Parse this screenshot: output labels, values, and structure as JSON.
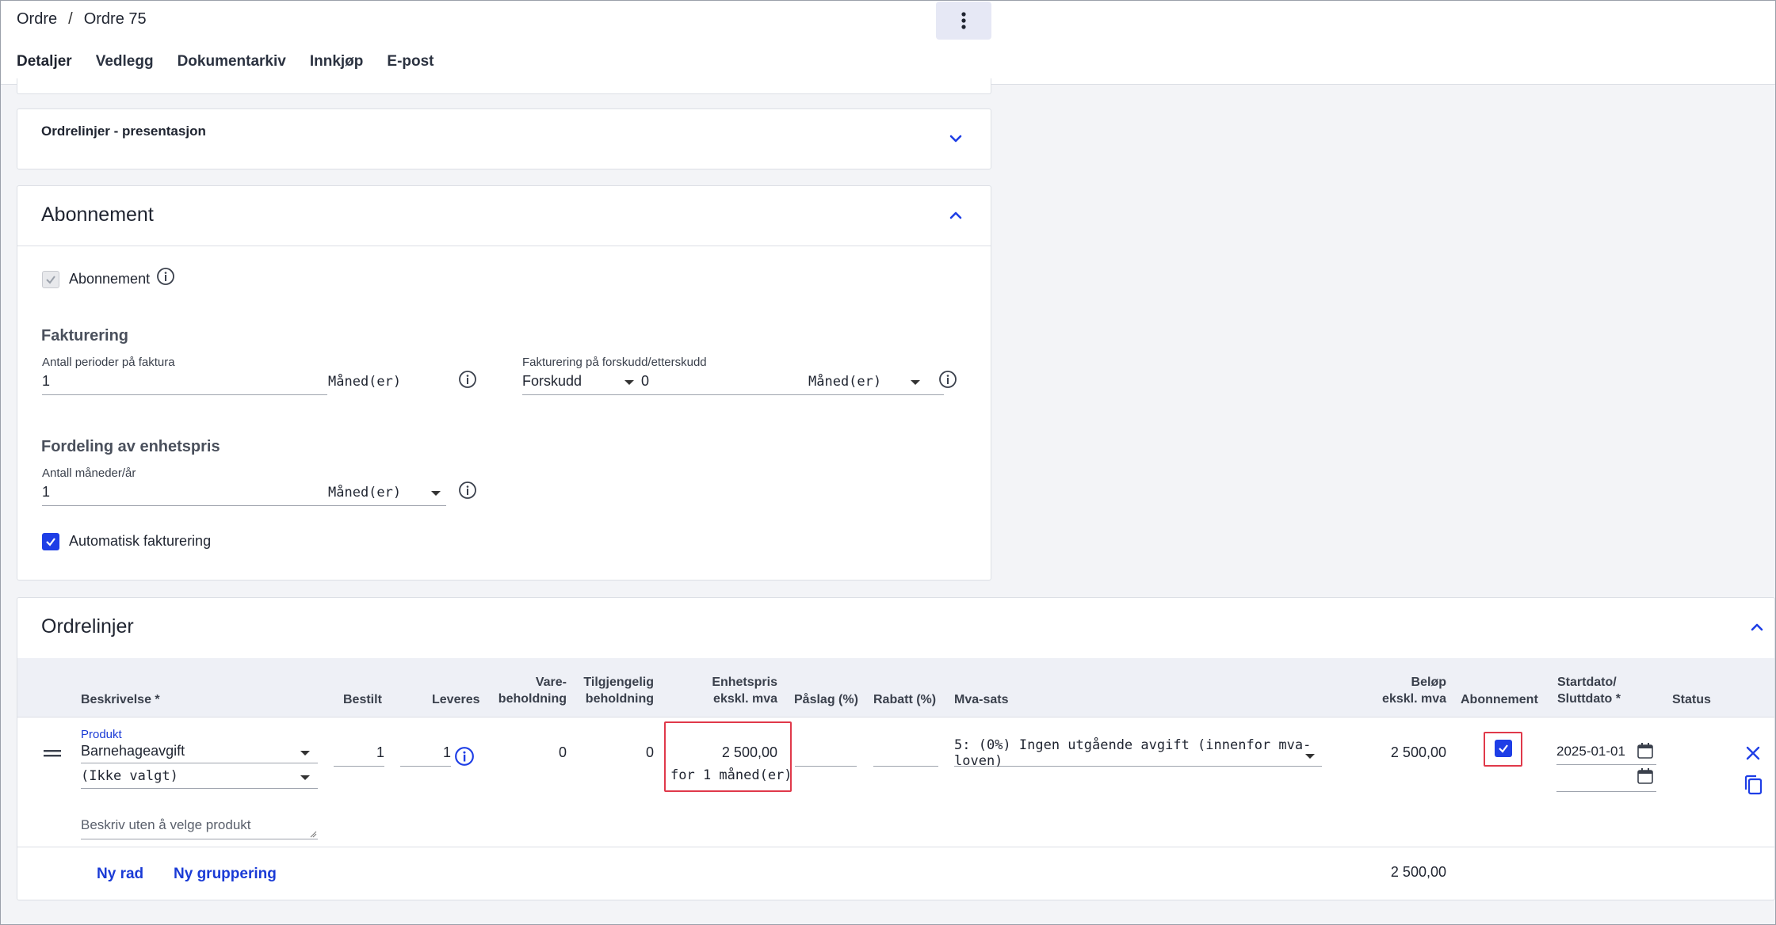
{
  "breadcrumb": {
    "parent": "Ordre",
    "separator": "/",
    "current": "Ordre 75"
  },
  "tabs": [
    {
      "label": "Detaljer",
      "active": true
    },
    {
      "label": "Vedlegg",
      "active": false
    },
    {
      "label": "Dokumentarkiv",
      "active": false
    },
    {
      "label": "Innkjøp",
      "active": false
    },
    {
      "label": "E-post",
      "active": false
    }
  ],
  "presentation": {
    "title": "Ordrelinjer - presentasjon"
  },
  "subscription": {
    "title": "Abonnement",
    "checkbox_label": "Abonnement",
    "billing": {
      "title": "Fakturering",
      "periods_label": "Antall perioder på faktura",
      "periods_value": "1",
      "periods_unit": "Måned(er)",
      "timing_label": "Fakturering på forskudd/etterskudd",
      "timing_value": "Forskudd",
      "timing_offset": "0",
      "timing_unit": "Måned(er)"
    },
    "distribution": {
      "title": "Fordeling av enhetspris",
      "months_label": "Antall måneder/år",
      "months_value": "1",
      "months_unit": "Måned(er)"
    },
    "auto_invoice_label": "Automatisk fakturering"
  },
  "orderlines": {
    "title": "Ordrelinjer",
    "columns": {
      "description": "Beskrivelse *",
      "ordered": "Bestilt",
      "delivered": "Leveres",
      "stock_1": "Vare-",
      "stock_2": "beholdning",
      "available_1": "Tilgjengelig",
      "available_2": "beholdning",
      "unitprice_1": "Enhetspris",
      "unitprice_2": "ekskl. mva",
      "markup": "Påslag (%)",
      "discount": "Rabatt (%)",
      "vat": "Mva-sats",
      "amount_1": "Beløp",
      "amount_2": "ekskl. mva",
      "subscription": "Abonnement",
      "dates_1": "Startdato/",
      "dates_2": "Sluttdato *",
      "status": "Status"
    },
    "row": {
      "product_label": "Produkt",
      "product": "Barnehageavgift",
      "variant": "(Ikke valgt)",
      "free_text_placeholder": "Beskriv uten å velge produkt",
      "ordered": "1",
      "delivered": "1",
      "stock": "0",
      "available": "0",
      "unit_price": "2 500,00",
      "unit_period": "for 1 måned(er)",
      "markup": "",
      "discount": "",
      "vat": "5: (0%) Ingen utgående avgift (innenfor mva-loven)",
      "amount": "2 500,00",
      "start_date": "2025-01-01",
      "end_date": ""
    },
    "new_row": "Ny rad",
    "new_group": "Ny gruppering",
    "total": "2 500,00"
  },
  "colors": {
    "accent": "#1e3ee6",
    "highlight": "#e0394a"
  }
}
